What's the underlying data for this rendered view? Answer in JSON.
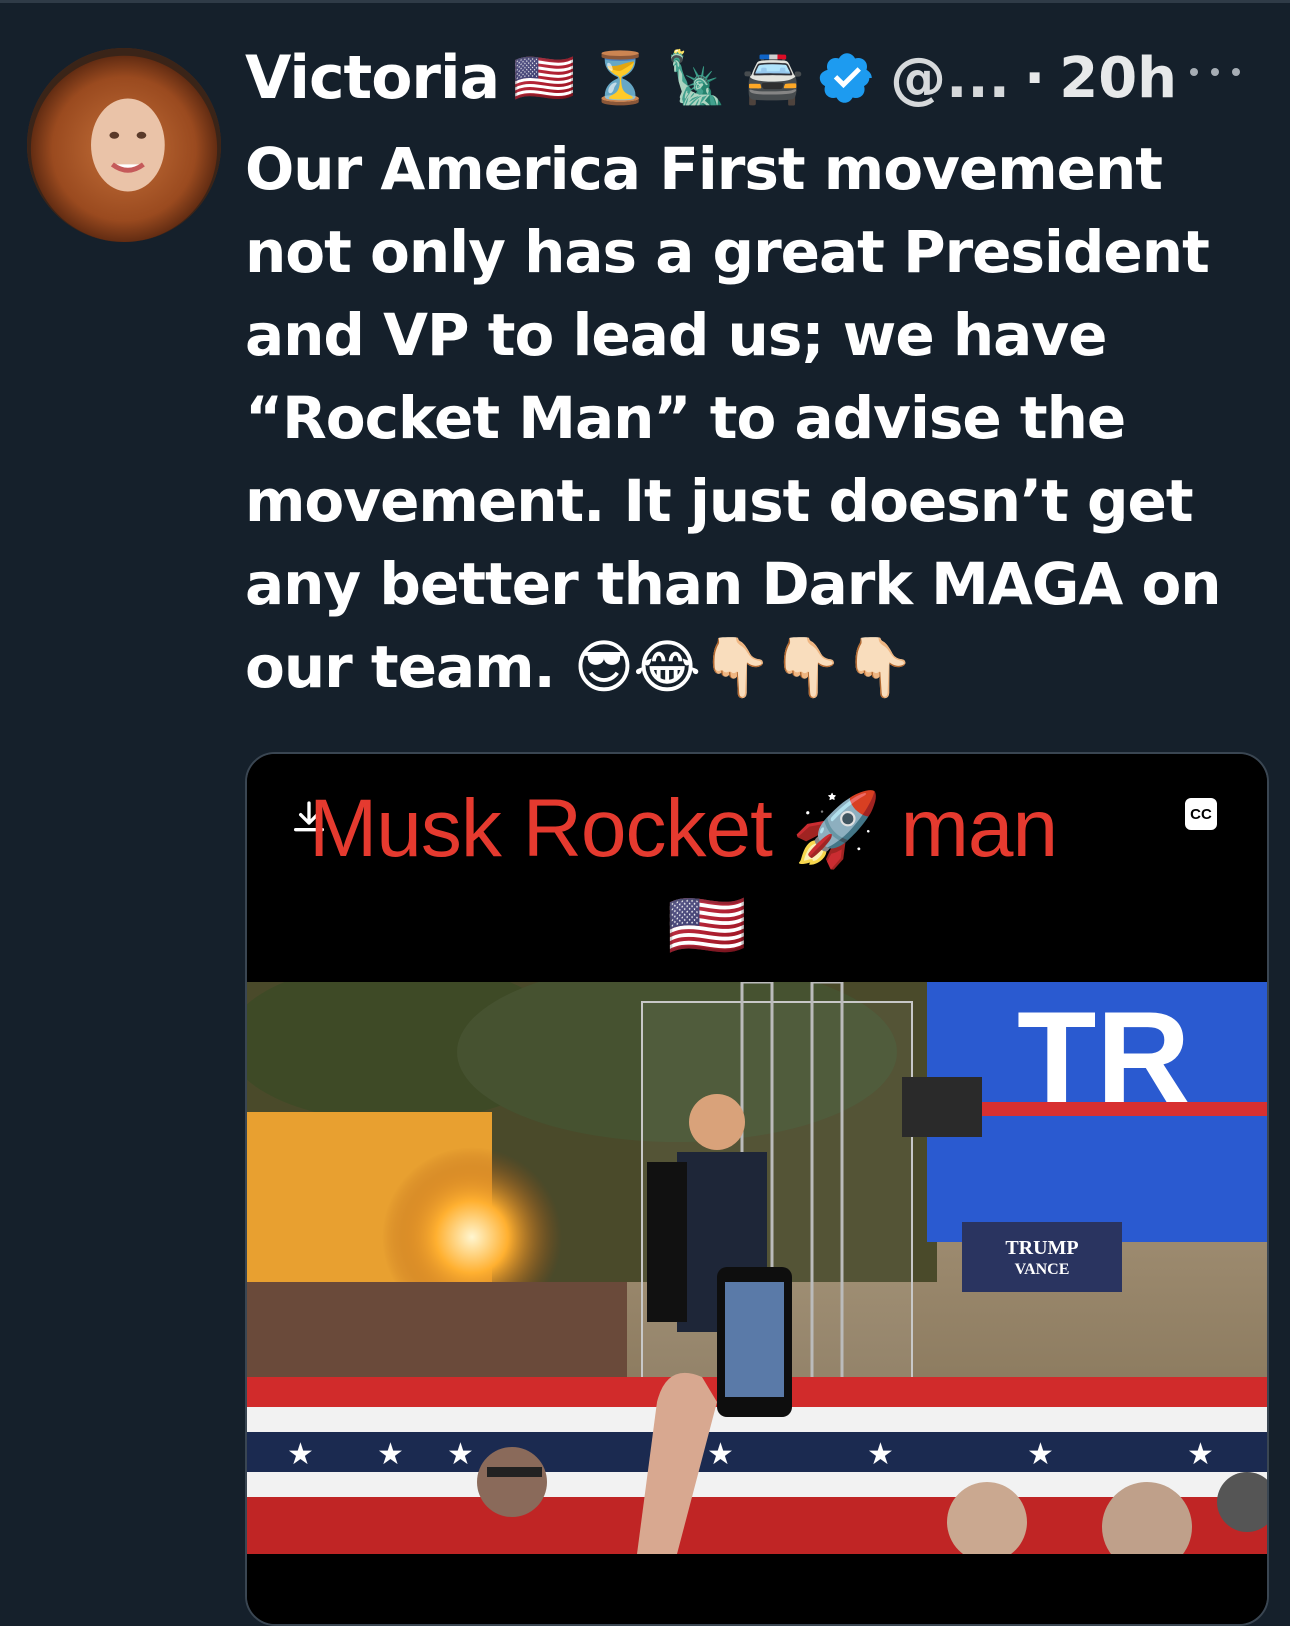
{
  "tweet": {
    "author_name": "Victoria",
    "name_emojis": [
      "🇺🇸",
      "⏳",
      "🗽",
      "🚔"
    ],
    "handle": "@...",
    "separator": "·",
    "time": "20h",
    "text": "Our America First movement not only has a great President and VP to lead us; we have “Rocket Man” to advise the movement. It just doesn’t get any better than Dark MAGA on our team. 😎😂👇🏻👇🏻👇🏻"
  },
  "media": {
    "title_left": "Musk Rocket",
    "title_emoji": "🚀",
    "title_right": "man",
    "flag_emoji": "🇺🇸",
    "cc_label": "CC",
    "scene_sign_1": "TRUMP",
    "scene_sign_2": "VANCE",
    "backdrop_text": "TR"
  },
  "colors": {
    "background": "#15202b",
    "verified_blue": "#1d9bf0",
    "title_red": "#e53a2f"
  },
  "icons": [
    "verified-badge-icon",
    "more-options-icon",
    "download-icon",
    "closed-captions-icon"
  ]
}
